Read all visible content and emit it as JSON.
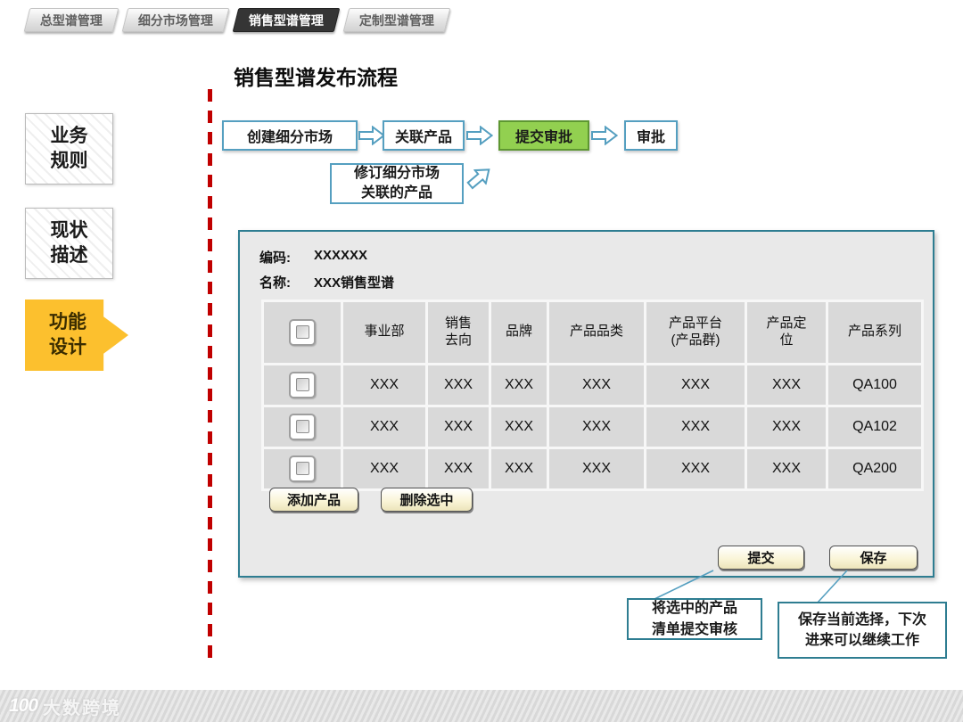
{
  "tabs": [
    {
      "label": "总型谱管理"
    },
    {
      "label": "细分市场管理"
    },
    {
      "label": "销售型谱管理"
    },
    {
      "label": "定制型谱管理"
    }
  ],
  "sidebar": {
    "items": [
      {
        "label": "业务\n规则"
      },
      {
        "label": "现状\n描述"
      },
      {
        "label": "功能\n设计"
      }
    ]
  },
  "page_title": "销售型谱发布流程",
  "flow": {
    "steps": [
      {
        "label": "创建细分市场"
      },
      {
        "label": "关联产品"
      },
      {
        "label": "提交审批"
      },
      {
        "label": "审批"
      }
    ],
    "alt_step": "修订细分市场\n关联的产品"
  },
  "panel": {
    "code_label": "编码:",
    "code_value": "XXXXXX",
    "name_label": "名称:",
    "name_value": "XXX销售型谱",
    "table": {
      "headers": [
        "事业部",
        "销售\n去向",
        "品牌",
        "产品品类",
        "产品平台\n(产品群)",
        "产品定\n位",
        "产品系列"
      ],
      "rows": [
        {
          "cells": [
            "XXX",
            "XXX",
            "XXX",
            "XXX",
            "XXX",
            "XXX",
            "QA100"
          ]
        },
        {
          "cells": [
            "XXX",
            "XXX",
            "XXX",
            "XXX",
            "XXX",
            "XXX",
            "QA102"
          ]
        },
        {
          "cells": [
            "XXX",
            "XXX",
            "XXX",
            "XXX",
            "XXX",
            "XXX",
            "QA200"
          ]
        }
      ]
    },
    "buttons": {
      "add": "添加产品",
      "delete": "删除选中",
      "submit": "提交",
      "save": "保存"
    }
  },
  "annotations": [
    {
      "text": "将选中的产品\n清单提交审核"
    },
    {
      "text": "保存当前选择，下次\n进来可以继续工作"
    }
  ],
  "footer": {
    "logo_mark": "100",
    "logo_text": "大数跨境"
  },
  "colors": {
    "accent_teal": "#2e7d91",
    "flow_blue": "#559fc0",
    "highlight_green": "#92d050",
    "sidebar_yellow": "#fcc02e",
    "divider_red": "#c00000"
  }
}
